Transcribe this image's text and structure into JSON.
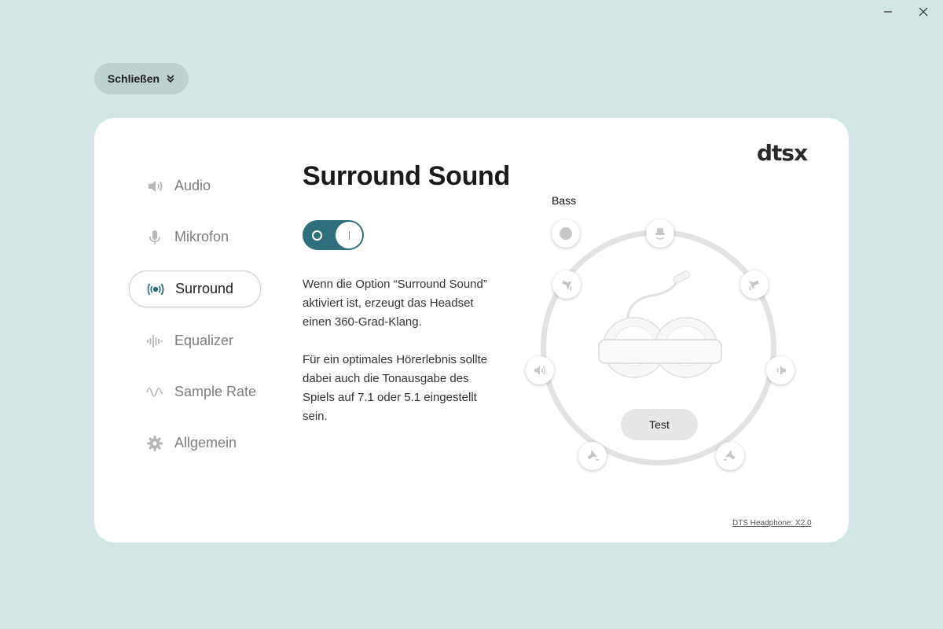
{
  "window": {
    "minimize_icon": "minimize-icon",
    "close_icon": "close-icon"
  },
  "close_menu": {
    "label": "Schließen",
    "icon": "double-chevron-down-icon"
  },
  "brand": {
    "logo_text": "dtsx",
    "accent": "#2f6f7c",
    "background": "#d3e6e6"
  },
  "sidebar": {
    "items": [
      {
        "label": "Audio",
        "icon": "speaker-icon",
        "active": false
      },
      {
        "label": "Mikrofon",
        "icon": "microphone-icon",
        "active": false
      },
      {
        "label": "Surround",
        "icon": "surround-icon",
        "active": true
      },
      {
        "label": "Equalizer",
        "icon": "equalizer-icon",
        "active": false
      },
      {
        "label": "Sample Rate",
        "icon": "sine-wave-icon",
        "active": false
      },
      {
        "label": "Allgemein",
        "icon": "gear-icon",
        "active": false
      }
    ]
  },
  "main": {
    "title": "Surround Sound",
    "toggle": {
      "state": "on"
    },
    "description": [
      "Wenn die Option “Surround Sound” aktiviert ist, erzeugt das Headset einen 360-Grad-Klang.",
      "Für ein optimales Hörerlebnis sollte dabei auch die Tonausgabe des Spiels auf 7.1 oder 5.1 eingestellt sein."
    ]
  },
  "diagram": {
    "bass_label": "Bass",
    "test_label": "Test",
    "speakers": [
      "bass",
      "center",
      "front-left",
      "front-right",
      "side-left",
      "side-right",
      "rear-left",
      "rear-right"
    ]
  },
  "footer": {
    "version": "DTS Headphone: X2.0"
  }
}
